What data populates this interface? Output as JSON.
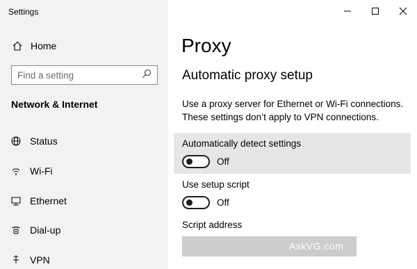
{
  "window": {
    "title": "Settings"
  },
  "sidebar": {
    "home_label": "Home",
    "search_placeholder": "Find a setting",
    "section_heading": "Network & Internet",
    "items": [
      {
        "label": "Status",
        "icon": "globe-icon"
      },
      {
        "label": "Wi-Fi",
        "icon": "wifi-icon"
      },
      {
        "label": "Ethernet",
        "icon": "ethernet-icon"
      },
      {
        "label": "Dial-up",
        "icon": "dialup-icon"
      },
      {
        "label": "VPN",
        "icon": "vpn-icon"
      }
    ]
  },
  "content": {
    "title": "Proxy",
    "subtitle": "Automatic proxy setup",
    "description": "Use a proxy server for Ethernet or Wi-Fi connections. These settings don’t apply to VPN connections.",
    "auto_detect": {
      "label": "Automatically detect settings",
      "state": "Off",
      "on": false
    },
    "setup_script": {
      "label": "Use setup script",
      "state": "Off",
      "on": false
    },
    "script_address": {
      "label": "Script address",
      "value": ""
    },
    "watermark": "AskVG.com"
  },
  "colors": {
    "sidebar_bg": "#f2f2f2",
    "highlight_bg": "#e6e6e6",
    "disabled_input": "#cccccc"
  }
}
